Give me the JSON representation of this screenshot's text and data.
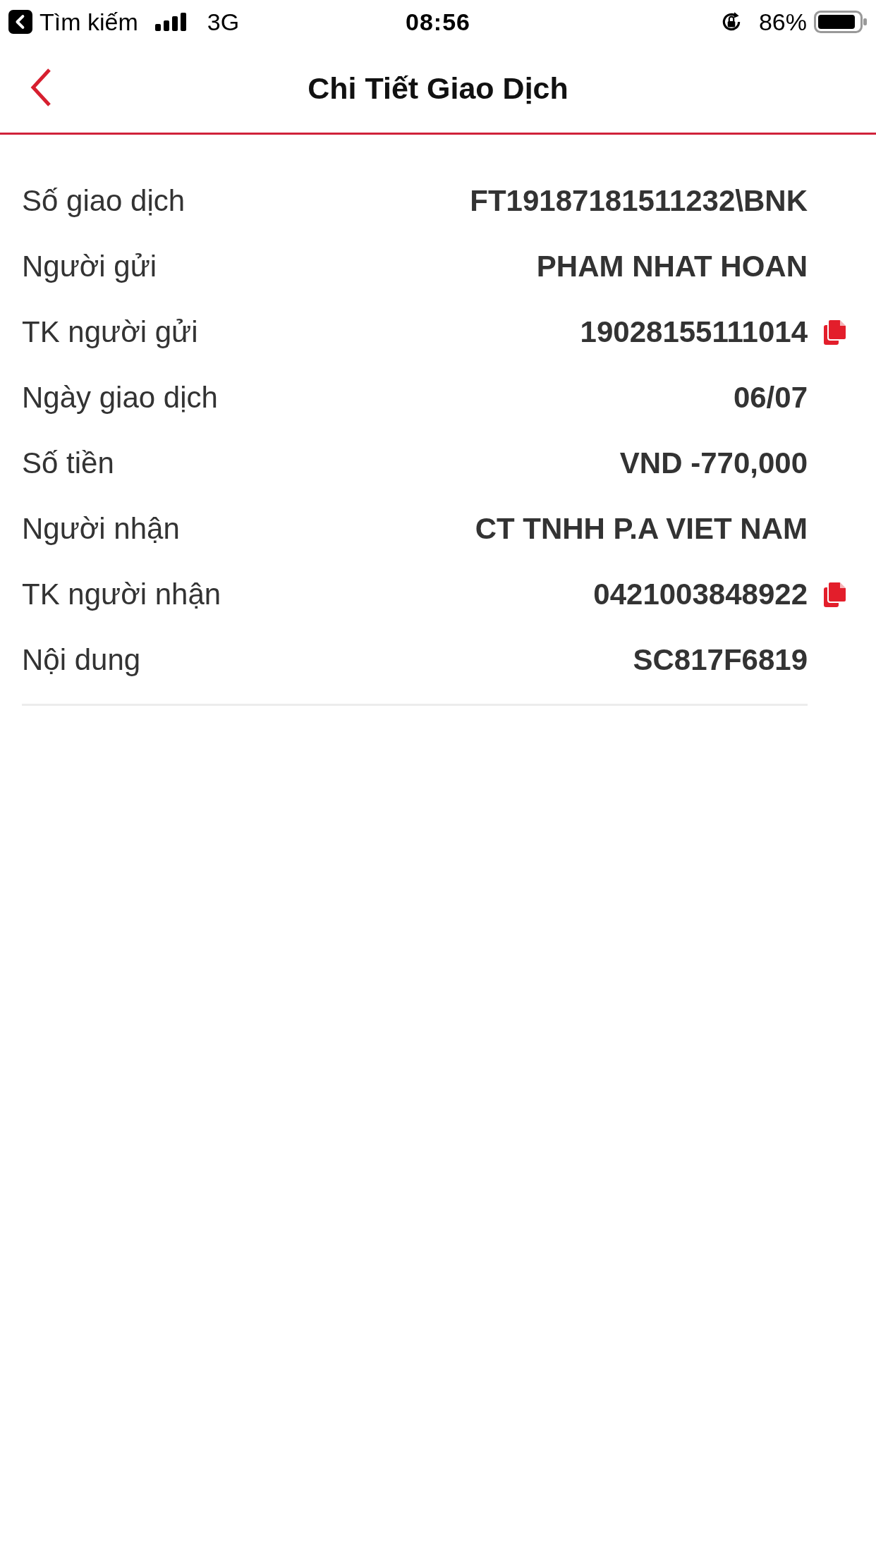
{
  "status_bar": {
    "back_app": "Tìm kiếm",
    "network": "3G",
    "time": "08:56",
    "battery": "86%"
  },
  "header": {
    "title": "Chi Tiết Giao Dịch"
  },
  "rows": [
    {
      "label": "Số giao dịch",
      "value": "FT19187181511232\\BNK",
      "copyable": false
    },
    {
      "label": "Người gửi",
      "value": "PHAM NHAT HOAN",
      "copyable": false
    },
    {
      "label": "TK người gửi",
      "value": "19028155111014",
      "copyable": true
    },
    {
      "label": "Ngày giao dịch",
      "value": "06/07",
      "copyable": false
    },
    {
      "label": "Số tiền",
      "value": "VND -770,000",
      "copyable": false
    },
    {
      "label": "Người nhận",
      "value": "CT TNHH P.A VIET NAM",
      "copyable": false
    },
    {
      "label": "TK người nhận",
      "value": "0421003848922",
      "copyable": true
    },
    {
      "label": "Nội dung",
      "value": "SC817F6819",
      "copyable": false
    }
  ]
}
